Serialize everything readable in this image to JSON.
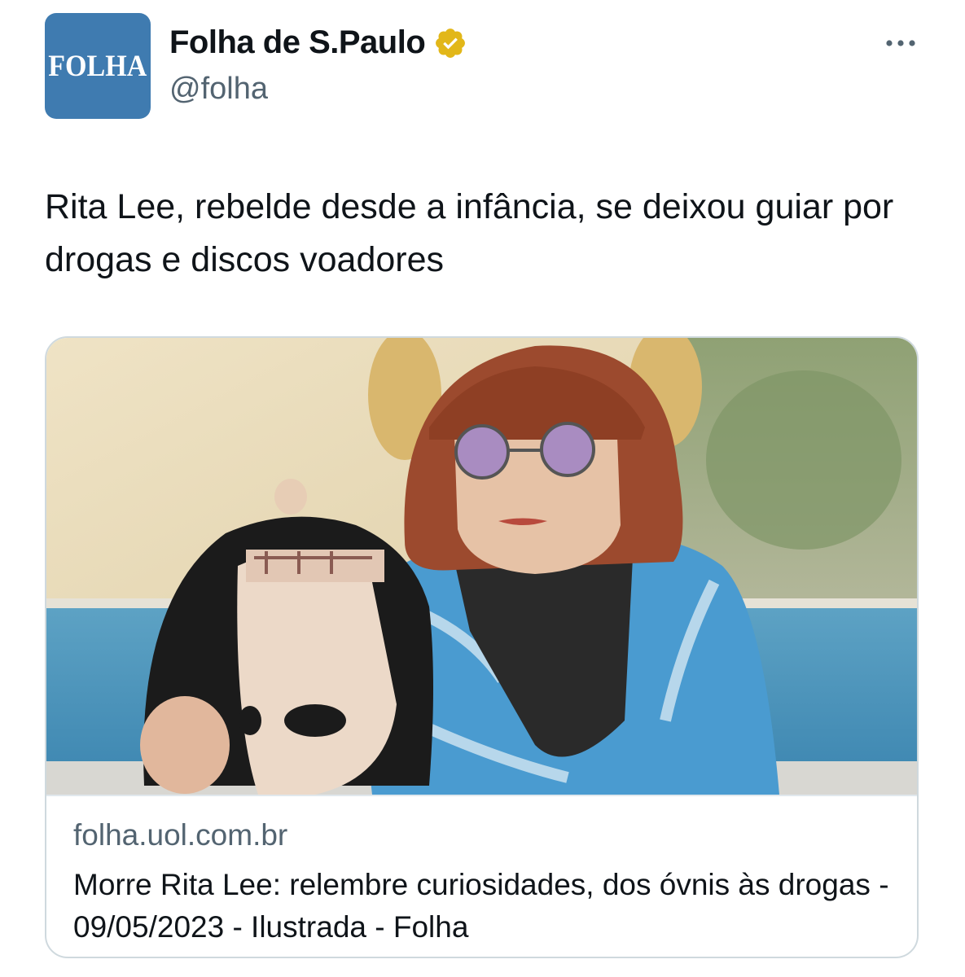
{
  "tweet": {
    "avatar_text": "FOLHA",
    "display_name": "Folha de S.Paulo",
    "handle": "@folha",
    "verified_badge": "gold-verified-icon",
    "more_icon": "more-options-icon",
    "text": "Rita Lee, rebelde desde a infância, se deixou guiar por drogas e discos voadores"
  },
  "card": {
    "domain": "folha.uol.com.br",
    "title": "Morre Rita Lee: relembre curiosidades, dos óvnis às drogas - 09/05/2023 - Ilustrada - Folha"
  },
  "colors": {
    "avatar_bg": "#3f7bb0",
    "verified_gold": "#e2b719",
    "muted_text": "#536471",
    "card_border": "#cfd9de"
  }
}
